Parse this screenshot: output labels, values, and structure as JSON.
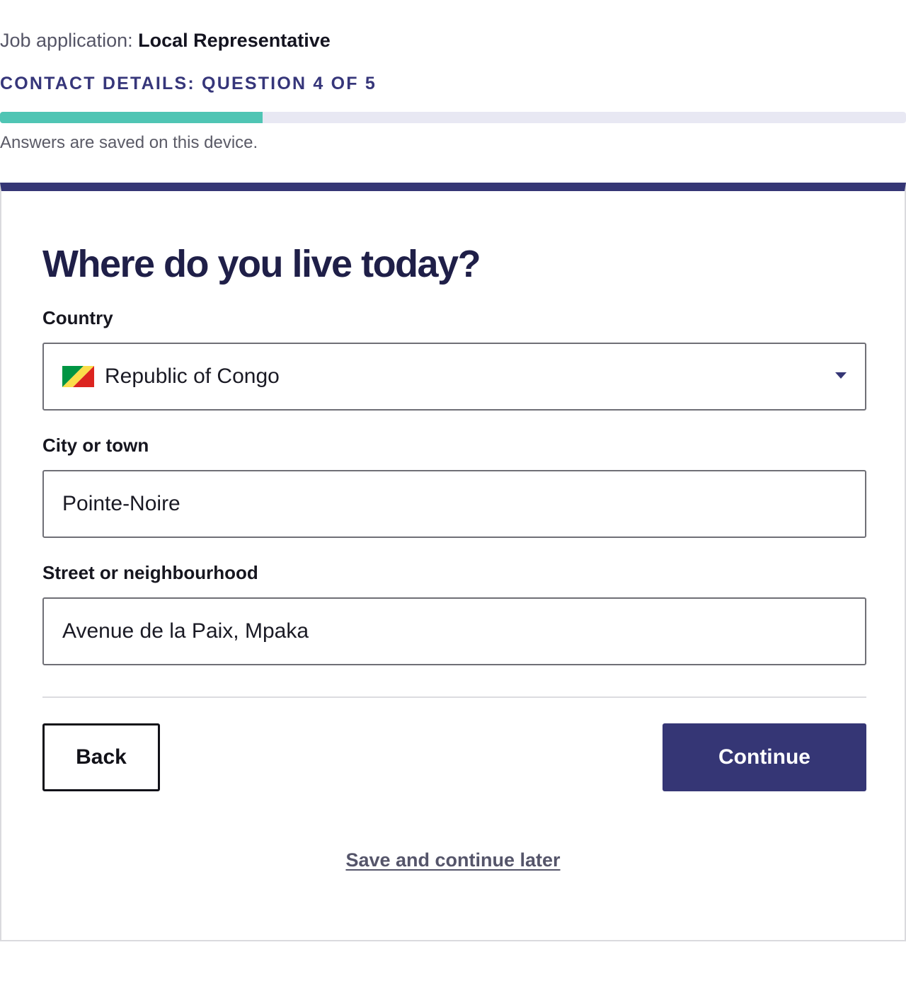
{
  "header": {
    "prefix": "Job application: ",
    "job_title": "Local Representative",
    "step_label": "CONTACT DETAILS: QUESTION 4 OF 5",
    "progress": 0.29,
    "progress_color": "#4fc5b4",
    "save_note": "Answers are saved on this device."
  },
  "form": {
    "question": "Where do you live today?",
    "country": {
      "label": "Country",
      "value": "Republic of Congo",
      "flag_icon": "republic-of-congo-flag-icon"
    },
    "city": {
      "label": "City or town",
      "value": "Pointe-Noire"
    },
    "street": {
      "label": "Street or neighbourhood",
      "value": "Avenue de la Paix, Mpaka"
    }
  },
  "actions": {
    "back_label": "Back",
    "continue_label": "Continue",
    "save_later_label": "Save and continue later"
  },
  "colors": {
    "brand": "#353675",
    "progress": "#4fc5b4",
    "track": "#e8e8f3"
  }
}
